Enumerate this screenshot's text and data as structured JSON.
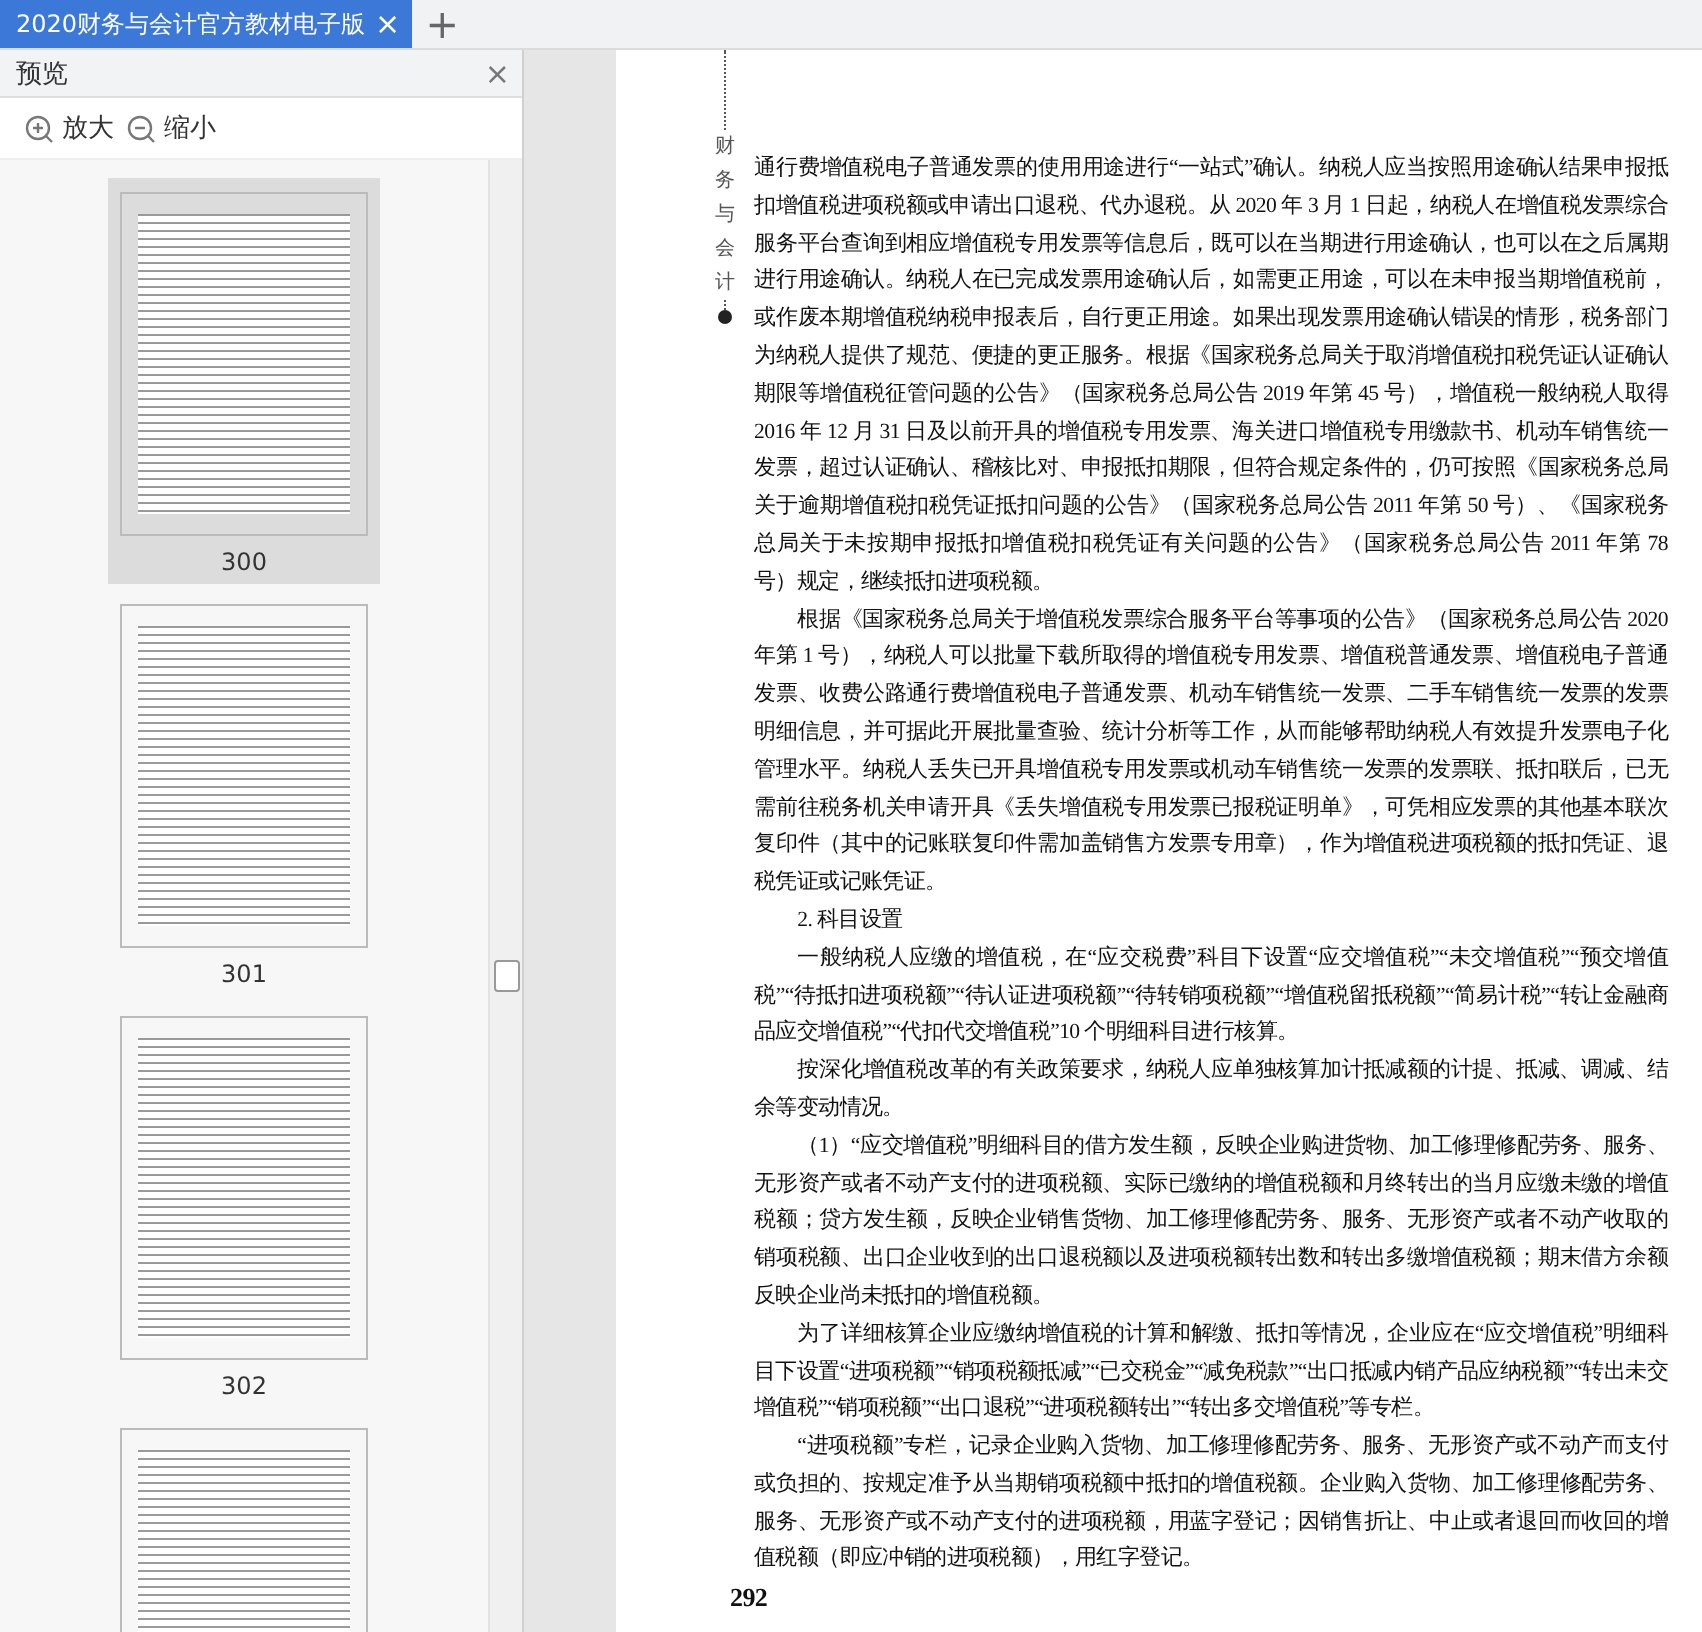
{
  "tabs": [
    {
      "label": "2020财务与会计官方教材电子版",
      "selected": true,
      "close": "×"
    }
  ],
  "new_tab": "+",
  "sidebar": {
    "title": "预览",
    "close": "×",
    "zoom_in": "放大",
    "zoom_out": "缩小",
    "thumbnails": [
      {
        "label": "300",
        "selected": true
      },
      {
        "label": "301",
        "selected": false
      },
      {
        "label": "302",
        "selected": false
      },
      {
        "selected": false
      }
    ]
  },
  "page": {
    "running_header": "财务与会计",
    "page_number": "292",
    "paragraphs": [
      {
        "indent": false,
        "text": "通行费增值税电子普通发票的使用用途进行“一站式”确认。纳税人应当按照用途确认结果申报抵扣增值税进项税额或申请出口退税、代办退税。从 2020 年 3 月 1 日起，纳税人在增值税发票综合服务平台查询到相应增值税专用发票等信息后，既可以在当期进行用途确认，也可以在之后属期进行用途确认。纳税人在已完成发票用途确认后，如需更正用途，可以在未申报当期增值税前，或作废本期增值税纳税申报表后，自行更正用途。如果出现发票用途确认错误的情形，税务部门为纳税人提供了规范、便捷的更正服务。根据《国家税务总局关于取消增值税扣税凭证认证确认期限等增值税征管问题的公告》（国家税务总局公告 2019 年第 45 号），增值税一般纳税人取得 2016 年 12 月 31 日及以前开具的增值税专用发票、海关进口增值税专用缴款书、机动车销售统一发票，超过认证确认、稽核比对、申报抵扣期限，但符合规定条件的，仍可按照《国家税务总局关于逾期增值税扣税凭证抵扣问题的公告》（国家税务总局公告 2011 年第 50 号）、《国家税务总局关于未按期申报抵扣增值税扣税凭证有关问题的公告》（国家税务总局公告 2011 年第 78 号）规定，继续抵扣进项税额。"
      },
      {
        "indent": true,
        "text": "根据《国家税务总局关于增值税发票综合服务平台等事项的公告》（国家税务总局公告 2020 年第 1 号），纳税人可以批量下载所取得的增值税专用发票、增值税普通发票、增值税电子普通发票、收费公路通行费增值税电子普通发票、机动车销售统一发票、二手车销售统一发票的发票明细信息，并可据此开展批量查验、统计分析等工作，从而能够帮助纳税人有效提升发票电子化管理水平。纳税人丢失已开具增值税专用发票或机动车销售统一发票的发票联、抵扣联后，已无需前往税务机关申请开具《丢失增值税专用发票已报税证明单》，可凭相应发票的其他基本联次复印件（其中的记账联复印件需加盖销售方发票专用章），作为增值税进项税额的抵扣凭证、退税凭证或记账凭证。"
      },
      {
        "indent": true,
        "text": "2. 科目设置"
      },
      {
        "indent": true,
        "text": "一般纳税人应缴的增值税，在“应交税费”科目下设置“应交增值税”“未交增值税”“预交增值税”“待抵扣进项税额”“待认证进项税额”“待转销项税额”“增值税留抵税额”“简易计税”“转让金融商品应交增值税”“代扣代交增值税”10 个明细科目进行核算。"
      },
      {
        "indent": true,
        "text": "按深化增值税改革的有关政策要求，纳税人应单独核算加计抵减额的计提、抵减、调减、结余等变动情况。"
      },
      {
        "indent": true,
        "text": "（1）“应交增值税”明细科目的借方发生额，反映企业购进货物、加工修理修配劳务、服务、无形资产或者不动产支付的进项税额、实际已缴纳的增值税额和月终转出的当月应缴未缴的增值税额；贷方发生额，反映企业销售货物、加工修理修配劳务、服务、无形资产或者不动产收取的销项税额、出口企业收到的出口退税额以及进项税额转出数和转出多缴增值税额；期末借方余额反映企业尚未抵扣的增值税额。"
      },
      {
        "indent": true,
        "text": "为了详细核算企业应缴纳增值税的计算和解缴、抵扣等情况，企业应在“应交增值税”明细科目下设置“进项税额”“销项税额抵减”“已交税金”“减免税款”“出口抵减内销产品应纳税额”“转出未交增值税”“销项税额”“出口退税”“进项税额转出”“转出多交增值税”等专栏。"
      },
      {
        "indent": true,
        "text": "“进项税额”专栏，记录企业购入货物、加工修理修配劳务、服务、无形资产或不动产而支付或负担的、按规定准予从当期销项税额中抵扣的增值税额。企业购入货物、加工修理修配劳务、服务、无形资产或不动产支付的进项税额，用蓝字登记；因销售折让、中止或者退回而收回的增值税额（即应冲销的进项税额），用红字登记。"
      }
    ]
  }
}
